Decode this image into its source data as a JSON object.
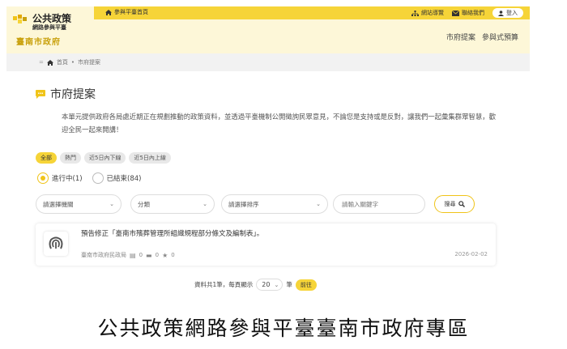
{
  "header": {
    "logo": {
      "title": "公共政策",
      "subtitle": "網路參與平臺",
      "org": "臺南市政府"
    },
    "topbar": {
      "home_link": "參與平臺首頁",
      "sitemap": "網站導覽",
      "contact": "聯絡我們",
      "login": "登入"
    },
    "nav": {
      "items": [
        "市府提案",
        "參與式預算"
      ]
    }
  },
  "breadcrumb": {
    "home": "首頁",
    "current": "市府提案"
  },
  "page": {
    "title": "市府提案",
    "description": "本單元提供政府各局處近期正在規劃推動的政策資料，並透過平臺機制公開徵詢民眾意見，不論您是支持或是反對，讓我們一起彙集群眾智慧，歡迎全民一起來開講！"
  },
  "filters": {
    "chips": [
      "全部",
      "熱門",
      "近5日內下線",
      "近5日內上線"
    ],
    "status": {
      "open_label": "進行中(1)",
      "closed_label": "已結束(84)"
    },
    "selects": {
      "agency": "請選擇機關",
      "category": "分類",
      "sort": "請選擇排序"
    },
    "keyword_placeholder": "請輸入關鍵字",
    "search_label": "搜尋"
  },
  "proposals": [
    {
      "title": "預告修正「臺南市殯葬管理所組織規程部分條文及編制表」。",
      "agency": "臺南市政府民政局",
      "comments": "0",
      "messages": "0",
      "likes": "0",
      "date": "2026-02-02"
    }
  ],
  "pagination": {
    "total_text": "資料共1筆，每頁顯示",
    "per_page": "20",
    "unit": "筆",
    "go_label": "前往"
  },
  "caption": "公共政策網路參與平臺臺南市政府專區",
  "colors": {
    "accent": "#f6d438",
    "header_bg": "#fdf7d8",
    "breadcrumb_bg": "#f2f2f2",
    "org_text": "#c9a10d"
  }
}
